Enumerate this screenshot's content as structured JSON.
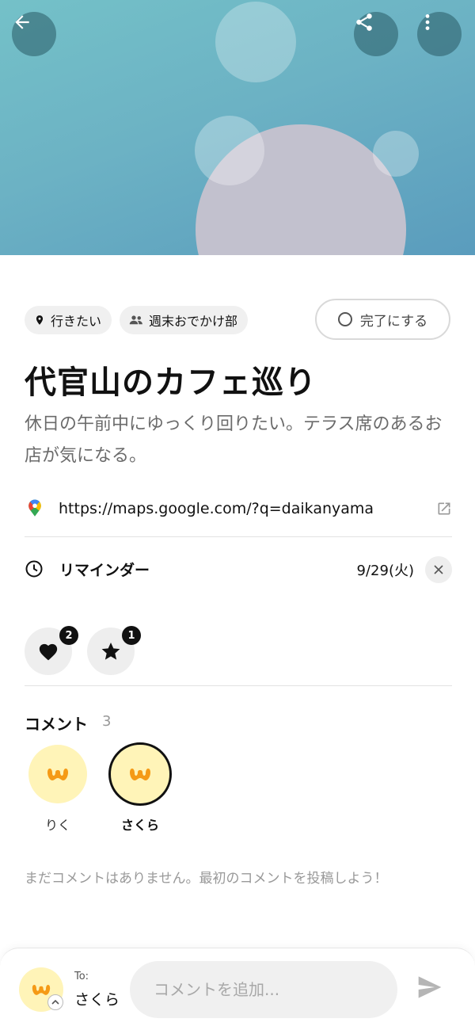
{
  "header": {
    "back_icon": "arrow-left-icon",
    "share_icon": "share-icon",
    "more_icon": "more-vertical-icon"
  },
  "tags": [
    {
      "label": "行きたい",
      "icon": "location-pin-icon"
    },
    {
      "label": "週末おでかけ部",
      "icon": "group-icon"
    }
  ],
  "done_button": {
    "label": "完了にする"
  },
  "item": {
    "title": "代官山のカフェ巡り",
    "description": "休日の午前中にゆっくり回りたい。テラス席のあるお店が気になる。"
  },
  "link": {
    "url": "https://maps.google.com/?q=daikanyama"
  },
  "reminder": {
    "label": "リマインダー",
    "date": "9/29(火)"
  },
  "reactions": [
    {
      "icon": "heart-icon",
      "count": "2"
    },
    {
      "icon": "star-icon",
      "count": "1"
    }
  ],
  "comments": {
    "heading": "コメント",
    "count": "3",
    "users": [
      {
        "name": "りく",
        "selected": false
      },
      {
        "name": "さくら",
        "selected": true
      }
    ],
    "empty_text": "まだコメントはありません。最初のコメントを投稿しよう！"
  },
  "composer": {
    "to_label": "To:",
    "to_name": "さくら",
    "placeholder": "コメントを追加..."
  },
  "colors": {
    "hero_teal": "#6cb2c4",
    "avatar_bg": "#fff4b8",
    "avatar_mark": "#f59a16",
    "maps_red": "#ea4335",
    "maps_green": "#34a853",
    "maps_blue": "#4285f4",
    "maps_yellow": "#fbbc04"
  }
}
